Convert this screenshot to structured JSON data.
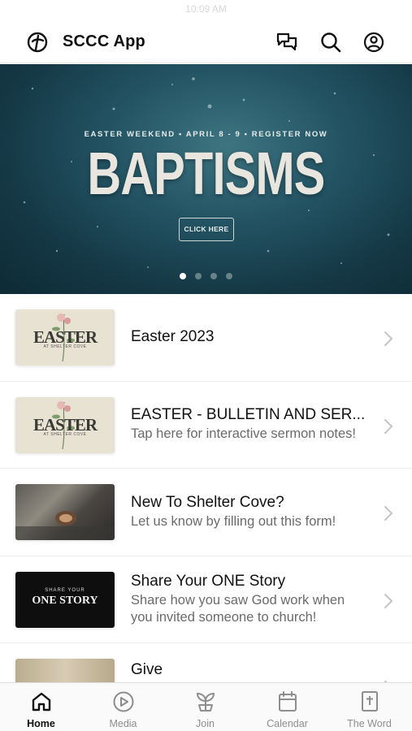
{
  "status_bar": {
    "time": "10:09 AM"
  },
  "header": {
    "app_title": "SCCC App",
    "logo_icon": "church-logo-icon",
    "actions": [
      "chat-icon",
      "search-icon",
      "profile-icon"
    ]
  },
  "hero": {
    "subtitle": "EASTER WEEKEND • APRIL 8 - 9 • REGISTER NOW",
    "title": "BAPTISMS",
    "cta_label": "CLICK HERE",
    "slide_count": 4,
    "active_slide": 1
  },
  "list": {
    "items": [
      {
        "title": "Easter 2023",
        "subtitle": "",
        "thumb_text": "EASTER",
        "thumb_small": "AT SHELTER COVE"
      },
      {
        "title": "EASTER - BULLETIN AND SER...",
        "subtitle": "Tap here for interactive sermon notes!",
        "thumb_text": "EASTER",
        "thumb_small": "AT SHELTER COVE"
      },
      {
        "title": "New To Shelter Cove?",
        "subtitle": "Let us know by filling out this form!"
      },
      {
        "title": "Share Your ONE Story",
        "subtitle": "Share how you saw God work when you invited someone to church!",
        "thumb_text_top": "SHARE YOUR",
        "thumb_text": "ONE STORY"
      },
      {
        "title": "Give",
        "subtitle": ""
      }
    ]
  },
  "tab_bar": {
    "tabs": [
      {
        "label": "Home",
        "icon": "home-icon",
        "active": true
      },
      {
        "label": "Media",
        "icon": "play-icon",
        "active": false
      },
      {
        "label": "Join",
        "icon": "sprout-icon",
        "active": false
      },
      {
        "label": "Calendar",
        "icon": "calendar-icon",
        "active": false
      },
      {
        "label": "The Word",
        "icon": "bible-icon",
        "active": false
      }
    ]
  },
  "colors": {
    "hero_bg": "#245565",
    "accent": "#111111",
    "tab_inactive": "#8e8e8e"
  }
}
